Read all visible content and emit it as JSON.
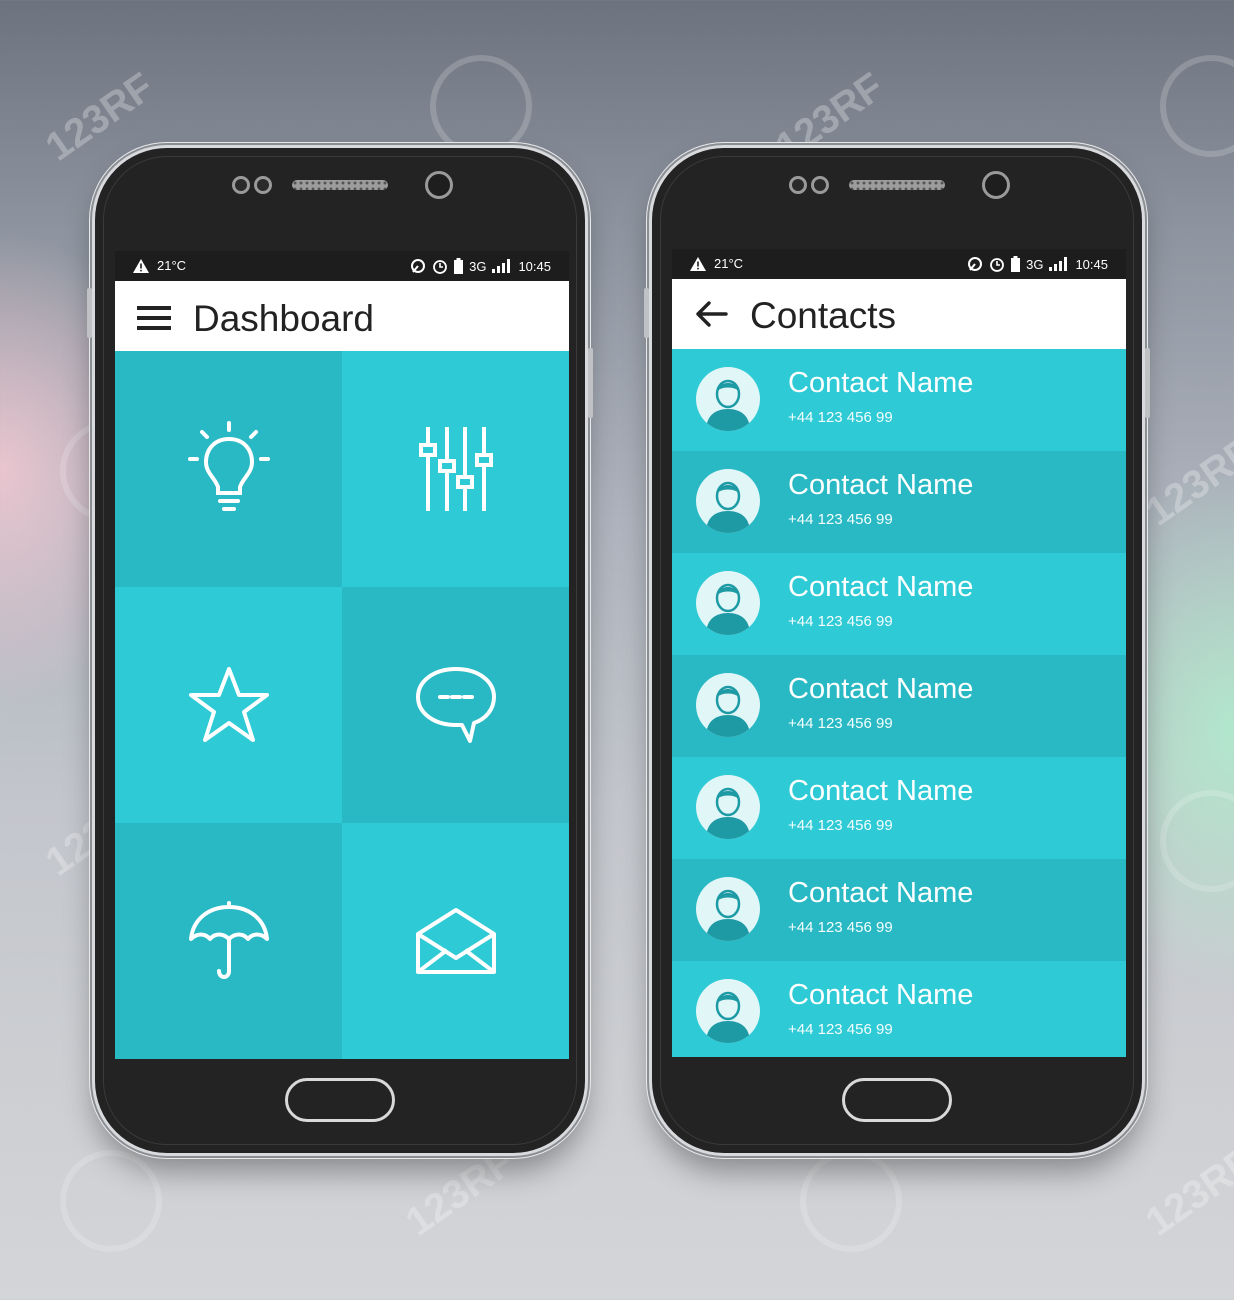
{
  "watermark": "123RF",
  "status_bar": {
    "temperature": "21°C",
    "network": "3G",
    "time": "10:45"
  },
  "dashboard": {
    "title": "Dashboard",
    "tiles": [
      {
        "icon": "lightbulb-icon"
      },
      {
        "icon": "equalizer-sliders-icon"
      },
      {
        "icon": "star-icon"
      },
      {
        "icon": "chat-bubble-icon"
      },
      {
        "icon": "umbrella-icon"
      },
      {
        "icon": "open-envelope-icon"
      }
    ]
  },
  "contacts": {
    "title": "Contacts",
    "items": [
      {
        "name": "Contact Name",
        "phone": "+44 123 456 99"
      },
      {
        "name": "Contact Name",
        "phone": "+44 123 456 99"
      },
      {
        "name": "Contact Name",
        "phone": "+44 123 456 99"
      },
      {
        "name": "Contact Name",
        "phone": "+44 123 456 99"
      },
      {
        "name": "Contact Name",
        "phone": "+44 123 456 99"
      },
      {
        "name": "Contact Name",
        "phone": "+44 123 456 99"
      },
      {
        "name": "Contact Name",
        "phone": "+44 123 456 99"
      }
    ]
  },
  "colors": {
    "accent": "#2ecad6",
    "accent_dark": "#29b9c4",
    "bezel": "#232323",
    "status_bar": "#1d1d1d"
  }
}
